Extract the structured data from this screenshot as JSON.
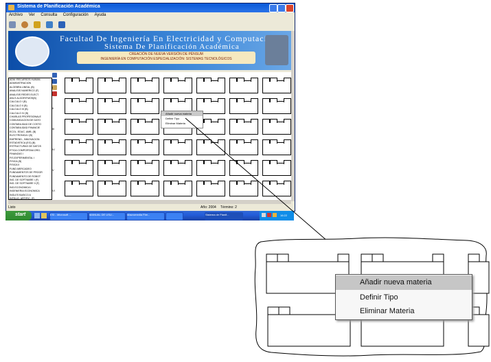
{
  "window": {
    "title": "Sistema de Planificación Académica",
    "menu": [
      "Archivo",
      "Ver",
      "Consulta",
      "Configuración",
      "Ayuda"
    ]
  },
  "toolbar_icons": [
    "gear-icon",
    "user-icon",
    "plus-icon",
    "tools-icon",
    "book-icon"
  ],
  "banner": {
    "line1": "Facultad De Ingeniería En Electricidad y Computación",
    "line2": "Sistema De Planificación Académica",
    "sub1": "CREACIÓN DE NUEVA VERSIÓN DE PÉNSUM",
    "sub2": "INGENIERÍA EN COMPUTACIÓN ESPECIALIZACIÓN: SISTEMAS TECNOLÓGICOS"
  },
  "course_list": [
    "ADM. RECURSOS HUMAN.",
    "ADMINISTRACION",
    "ALGEBRA LINEAL (B)",
    "ANALISIS NUMERICO (F)",
    "ANALISIS REDES ELECT.",
    "ANLS ALGORITMOS(B)",
    "CALCULO I (B)",
    "CALCULO II (B)",
    "CALCULO III (B)",
    "CALCULO IV (B)",
    "CHARLAS PROFESIONALE",
    "COMUNICACION DE DATO",
    "CONTABILIDAD DE COSTO",
    "CONTABILIDAD FINANCIE",
    "ECOL. EDUC. AMB. (B)",
    "ELECTRONICA I (B)",
    "EMPREND., INNOVACION",
    "ESTADISTICA (EG) (B)",
    "ESTRUCTURAS DE DATOS",
    "ETICA COMPORTAM.ORG.",
    "FINANZAS I",
    "FIS.EXPERIMENTAL I",
    "FISICA (B)",
    "FISICA II",
    "FUND.MERCADEO",
    "FUNDAMENTOS DE PROGR",
    "FUNDAMENTO DE ROBOT",
    "ING. DE SOFTWARE I (F)",
    "ING. DE SOFTWARE II (F)",
    "ING.ECONOMICA I",
    "INGENIERIA ECONOMICA",
    "INGLES BASICO A",
    "INTELIG. ARTIFIC. (F)",
    "INTERAC. HOMBRE MAQUI"
  ],
  "row_labels": [
    "I",
    "II",
    "III",
    "IV",
    "V",
    "VI",
    "VII",
    "VIII"
  ],
  "context_menu": {
    "items": [
      "Añadir nueva materia",
      "Definir Tipo",
      "Eliminar Materia"
    ],
    "selected_index": 0
  },
  "statusbar": {
    "left": "Listo",
    "year_label": "Año: 2004",
    "term_label": "Término: 2"
  },
  "taskbar": {
    "start": "start",
    "tasks": [
      "ESI - Microsoft ...",
      "MANUAL DE USU...",
      "Macromedia Fire...",
      "",
      "Sistema de Planif..."
    ],
    "clock": "16:22"
  },
  "colors": {
    "banner_blue": "#0c4da8",
    "subtitle_box": "#f6e9bf",
    "taskbar_blue": "#245edb",
    "start_green": "#3c9a3c",
    "menu_highlight": "#c6c6c6"
  }
}
